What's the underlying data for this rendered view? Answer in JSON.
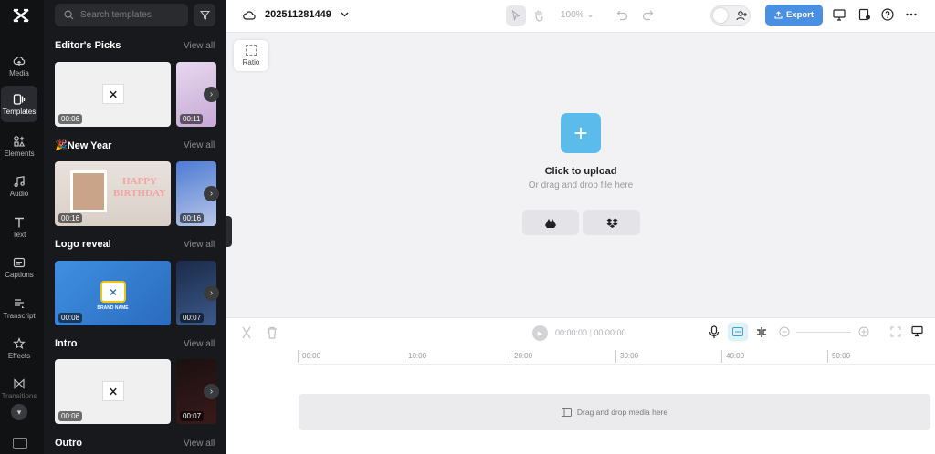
{
  "rail": {
    "items": [
      {
        "label": "Media",
        "icon": "cloud-upload-icon"
      },
      {
        "label": "Templates",
        "icon": "templates-icon",
        "active": true
      },
      {
        "label": "Elements",
        "icon": "elements-icon"
      },
      {
        "label": "Audio",
        "icon": "music-icon"
      },
      {
        "label": "Text",
        "icon": "text-icon"
      },
      {
        "label": "Captions",
        "icon": "captions-icon"
      },
      {
        "label": "Transcript",
        "icon": "transcript-icon"
      },
      {
        "label": "Effects",
        "icon": "effects-icon"
      },
      {
        "label": "Transitions",
        "icon": "transitions-icon"
      }
    ]
  },
  "search": {
    "placeholder": "Search templates"
  },
  "sections": [
    {
      "title": "Editor's Picks",
      "view_all": "View all",
      "durations": [
        "00:06",
        "00:11"
      ]
    },
    {
      "title": "🎉New Year",
      "view_all": "View all",
      "durations": [
        "00:16",
        "00:16"
      ],
      "thumb_text": "HAPPY BIRTHDAY"
    },
    {
      "title": "Logo reveal",
      "view_all": "View all",
      "durations": [
        "00:08",
        "00:07"
      ],
      "thumb_text": "BRAND NAME"
    },
    {
      "title": "Intro",
      "view_all": "View all",
      "durations": [
        "00:06",
        "00:07"
      ]
    },
    {
      "title": "Outro",
      "view_all": "View all"
    }
  ],
  "project": {
    "name": "202511281449"
  },
  "toolbar": {
    "zoom": "100%",
    "export_label": "Export"
  },
  "canvas": {
    "ratio_label": "Ratio",
    "upload_title": "Click to upload",
    "upload_sub": "Or drag and drop file here"
  },
  "timeline": {
    "current_time": "00:00:00",
    "total_time": "00:00:00",
    "ticks": [
      "00:00",
      "10:00",
      "20:00",
      "30:00",
      "40:00",
      "50:00"
    ],
    "drop_label": "Drag and drop media here"
  },
  "colors": {
    "accent": "#4a90e2",
    "upload": "#5bbbea",
    "rail_bg": "#111214",
    "panel_bg": "#18191c"
  }
}
